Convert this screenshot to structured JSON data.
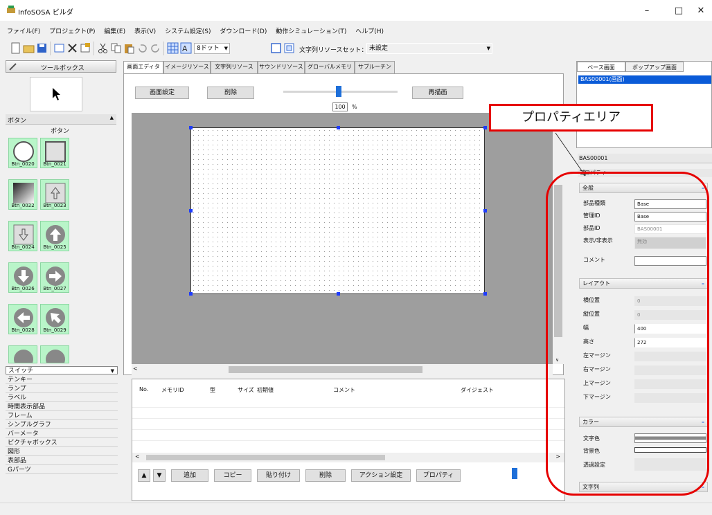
{
  "window": {
    "title": "InfoSOSA ビルダ",
    "minimize": "–",
    "maximize": "□",
    "close": "✕"
  },
  "menu": [
    "ファイル(F)",
    "プロジェクト(P)",
    "編集(E)",
    "表示(V)",
    "システム設定(S)",
    "ダウンロード(D)",
    "動作シミュレーション(T)",
    "ヘルプ(H)"
  ],
  "toolbar": {
    "font_size": "8ドット",
    "charset_label": "文字列リソースセット：",
    "charset_value": "未設定"
  },
  "toolbox": {
    "title": "ツールボックス",
    "group": "ボタン",
    "group_sub": "ボタン",
    "tiles": [
      "Btn_0020",
      "Btn_0021",
      "Btn_0022",
      "Btn_0023",
      "Btn_0024",
      "Btn_0025",
      "Btn_0026",
      "Btn_0027",
      "Btn_0028",
      "Btn_0029"
    ],
    "categories": [
      "スイッチ",
      "テンキー",
      "ランプ",
      "ラベル",
      "時間表示部品",
      "フレーム",
      "シンプルグラフ",
      "バーメータ",
      "ピクチャボックス",
      "図形",
      "表部品",
      "Gパーツ"
    ]
  },
  "tabs": [
    "画面エディタ",
    "イメージリソース",
    "文字列リソース",
    "サウンドリソース",
    "グローバルメモリ",
    "サブルーチン"
  ],
  "editor": {
    "screen_settings": "画面設定",
    "delete": "削除",
    "redraw": "再描画",
    "zoom_value": "100",
    "zoom_unit": "%"
  },
  "memory_table": {
    "columns": [
      "No.",
      "メモリID",
      "型",
      "サイズ",
      "初期値",
      "コメント",
      "ダイジェスト"
    ],
    "buttons": [
      "追加",
      "コピー",
      "貼り付け",
      "削除",
      "アクション設定",
      "プロパティ"
    ]
  },
  "right": {
    "tabs": [
      "ベース画面",
      "ポップアップ画面"
    ],
    "selected_item": "BAS00001(画面)",
    "object_id": "BAS00001",
    "object_type": "プロパティ"
  },
  "properties": {
    "general": {
      "title": "全般",
      "rows": [
        [
          "部品種類",
          "Base"
        ],
        [
          "管理ID",
          "Base"
        ],
        [
          "部品ID",
          "BAS00001"
        ],
        [
          "表示/非表示",
          "無効"
        ],
        [
          "コメント",
          ""
        ]
      ]
    },
    "layout": {
      "title": "レイアウト",
      "rows": [
        [
          "横位置",
          "0"
        ],
        [
          "縦位置",
          "0"
        ],
        [
          "幅",
          "400"
        ],
        [
          "高さ",
          "272"
        ],
        [
          "左マージン",
          ""
        ],
        [
          "右マージン",
          ""
        ],
        [
          "上マージン",
          ""
        ],
        [
          "下マージン",
          ""
        ]
      ]
    },
    "color": {
      "title": "カラー",
      "rows": [
        [
          "文字色",
          ""
        ],
        [
          "背景色",
          ""
        ],
        [
          "透過設定",
          ""
        ]
      ]
    },
    "text": {
      "title": "文字列"
    }
  },
  "annotation": {
    "callout": "プロパティエリア"
  },
  "colors": {
    "annotation": "#e60000",
    "selection": "#0a5bd8",
    "tile": "#b9f5c9"
  }
}
